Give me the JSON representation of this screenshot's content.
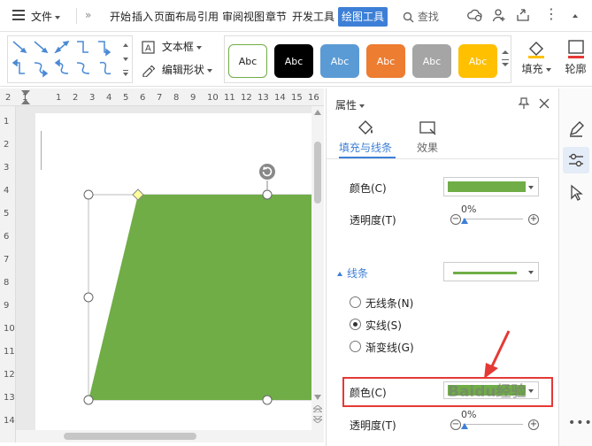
{
  "menubar": {
    "file_label": "文件",
    "overflow_label": "»",
    "tabs": [
      "开始",
      "插入",
      "页面布局",
      "引用",
      "审阅",
      "视图",
      "章节",
      "开发工具"
    ],
    "active_tab": "绘图工具",
    "search_label": "查找"
  },
  "ribbon": {
    "textbox_label": "文本框",
    "edit_shape_label": "编辑形状",
    "style_samples": [
      {
        "label": "Abc",
        "bg": "#ffffff",
        "fg": "#222222",
        "border": "#70ad47"
      },
      {
        "label": "Abc",
        "bg": "#000000",
        "fg": "#ffffff",
        "border": "#000000"
      },
      {
        "label": "Abc",
        "bg": "#5b9bd5",
        "fg": "#ffffff",
        "border": "#5b9bd5"
      },
      {
        "label": "Abc",
        "bg": "#ed7d31",
        "fg": "#ffffff",
        "border": "#ed7d31"
      },
      {
        "label": "Abc",
        "bg": "#a5a5a5",
        "fg": "#ffffff",
        "border": "#a5a5a5"
      },
      {
        "label": "Abc",
        "bg": "#ffc000",
        "fg": "#ffffff",
        "border": "#ffc000"
      }
    ],
    "fill_label": "填充",
    "outline_label": "轮廓"
  },
  "ruler": {
    "top_ticks": [
      "2",
      "1",
      "",
      "1",
      "2",
      "3",
      "4",
      "5",
      "6",
      "7",
      "8",
      "9",
      "10",
      "11",
      "12",
      "13",
      "14",
      "15",
      "16"
    ],
    "left_ticks": [
      "1",
      "2",
      "3",
      "4",
      "5",
      "6",
      "7",
      "8",
      "9",
      "10",
      "11",
      "12",
      "13",
      "14"
    ]
  },
  "document": {
    "shape_fill": "#70ad47",
    "handle_color": "#ffff99"
  },
  "panel": {
    "title": "属性",
    "tab_fill_line": "填充与线条",
    "tab_effects": "效果",
    "fill_color_label": "颜色(C)",
    "fill_color": "#70ad47",
    "transparency_label": "透明度(T)",
    "transparency_value": "0%",
    "lines_section": "线条",
    "line_options": [
      "无线条(N)",
      "实线(S)",
      "渐变线(G)"
    ],
    "line_selected_index": 1,
    "line_color_label": "颜色(C)",
    "line_color": "#70ad47",
    "line_transparency_label": "透明度(T)",
    "line_transparency_value": "0%"
  },
  "watermark": "Baidu经验"
}
